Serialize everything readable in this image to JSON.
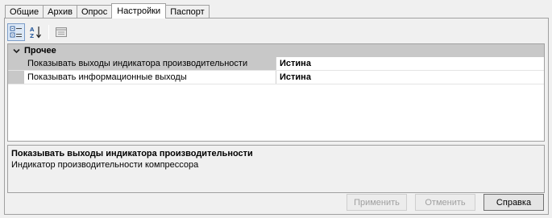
{
  "tabs": [
    {
      "label": "Общие"
    },
    {
      "label": "Архив"
    },
    {
      "label": "Опрос"
    },
    {
      "label": "Настройки",
      "active": true
    },
    {
      "label": "Паспорт"
    }
  ],
  "toolbar": {
    "categorized_icon": "categorized-icon",
    "alphabetical_icon": "sort-az-icon",
    "pages_icon": "property-pages-icon"
  },
  "grid": {
    "category": {
      "label": "Прочее",
      "expanded": true
    },
    "properties": [
      {
        "name": "Показывать выходы индикатора производительности",
        "value": "Истина"
      },
      {
        "name": "Показывать информационные выходы",
        "value": "Истина"
      }
    ]
  },
  "description": {
    "title": "Показывать выходы индикатора производительности",
    "text": "Индикатор производительности компрессора"
  },
  "buttons": {
    "apply": "Применить",
    "cancel": "Отменить",
    "help": "Справка"
  }
}
